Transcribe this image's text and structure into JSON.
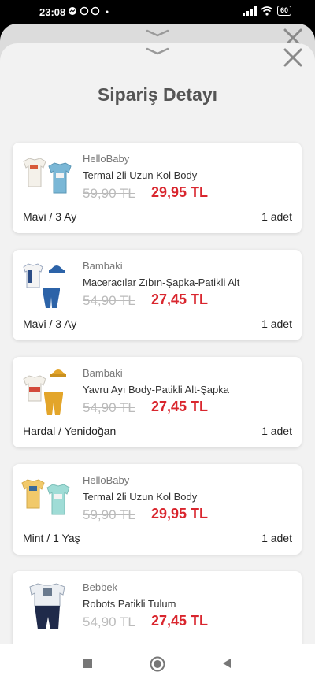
{
  "status_bar": {
    "time": "23:08",
    "notifications": [
      "messenger-icon",
      "threads-icon",
      "threads-icon",
      "dot"
    ],
    "battery": "60"
  },
  "sheet": {
    "title": "Sipariş Detayı"
  },
  "items": [
    {
      "brand": "HelloBaby",
      "name": "Termal 2li Uzun Kol Body",
      "old_price": "59,90 TL",
      "price": "29,95 TL",
      "variant": "Mavi / 3 Ay",
      "quantity": "1 adet",
      "image": "two-bodysuits-white-blue"
    },
    {
      "brand": "Bambaki",
      "name": "Maceracılar Zıbın-Şapka-Patikli Alt",
      "old_price": "54,90 TL",
      "price": "27,45 TL",
      "variant": "Mavi / 3 Ay",
      "quantity": "1 adet",
      "image": "baby-set-blue"
    },
    {
      "brand": "Bambaki",
      "name": "Yavru Ayı Body-Patikli Alt-Şapka",
      "old_price": "54,90 TL",
      "price": "27,45 TL",
      "variant": "Hardal / Yenidoğan",
      "quantity": "1 adet",
      "image": "baby-set-mustard"
    },
    {
      "brand": "HelloBaby",
      "name": "Termal 2li Uzun Kol Body",
      "old_price": "59,90 TL",
      "price": "29,95 TL",
      "variant": "Mint / 1 Yaş",
      "quantity": "1 adet",
      "image": "two-bodysuits-yellow-mint"
    },
    {
      "brand": "Bebbek",
      "name": "Robots Patikli Tulum",
      "old_price": "54,90 TL",
      "price": "27,45 TL",
      "variant": "",
      "quantity": "",
      "image": "robots-romper-navy"
    }
  ],
  "colors": {
    "price_red": "#d9262e",
    "old_price_gray": "#bbbbbb",
    "sheet_bg": "#f2f2f2",
    "title_gray": "#555555"
  }
}
